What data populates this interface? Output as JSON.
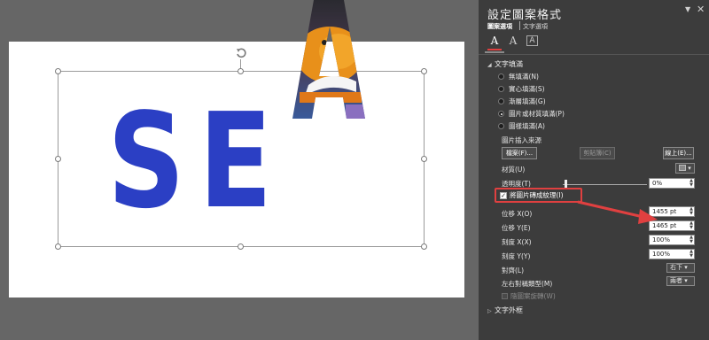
{
  "slide": {
    "letters": [
      "S",
      "E",
      "A"
    ]
  },
  "panel": {
    "title": "設定圖案格式",
    "tabs": {
      "shape_options": "圖案選項",
      "text_options": "文字選項"
    },
    "icons": [
      "text-fill-icon",
      "text-outline-icon",
      "textbox-icon"
    ],
    "text_fill_section": "文字填滿",
    "fill_options": [
      {
        "label": "無填滿(N)",
        "selected": false
      },
      {
        "label": "實心填滿(S)",
        "selected": false
      },
      {
        "label": "漸層填滿(G)",
        "selected": false
      },
      {
        "label": "圖片或材質填滿(P)",
        "selected": true
      },
      {
        "label": "圖樣填滿(A)",
        "selected": false
      }
    ],
    "picture_source_label": "圖片插入來源",
    "buttons": {
      "file": "檔案(F)...",
      "clipboard": "剪貼簿(C)",
      "online": "線上(E)..."
    },
    "texture_label": "材質(U)",
    "transparency_label": "透明度(T)",
    "transparency_value": "0%",
    "tile_checkbox_label": "將圖片磚成紋理(I)",
    "tile_checked": true,
    "offset_x_label": "位移 X(O)",
    "offset_x_value": "1455 pt",
    "offset_y_label": "位移 Y(E)",
    "offset_y_value": "1465 pt",
    "scale_x_label": "刻度 X(X)",
    "scale_x_value": "100%",
    "scale_y_label": "刻度 Y(Y)",
    "scale_y_value": "100%",
    "alignment_label": "對齊(L)",
    "alignment_value": "右下",
    "mirror_label": "左右對稱類型(M)",
    "mirror_value": "兩者",
    "rotate_with_shape_label": "隨圖案旋轉(W)",
    "text_outline_section": "文字外框"
  },
  "colors": {
    "letters": "#2b3fc4",
    "highlight": "#e04040",
    "panel_bg": "#3c3c3c"
  }
}
